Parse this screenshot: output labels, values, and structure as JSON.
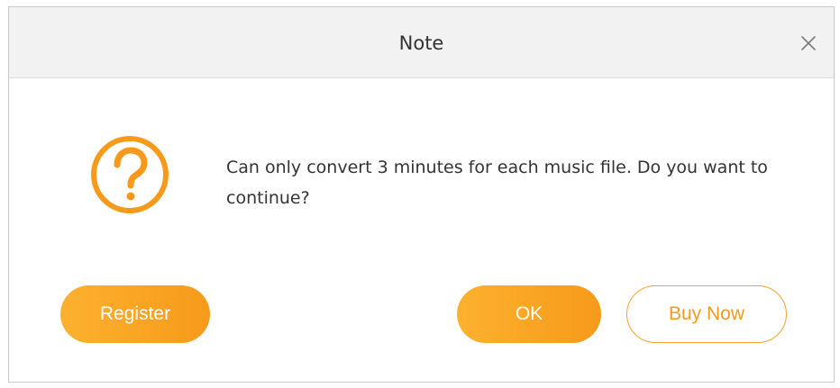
{
  "dialog": {
    "title": "Note",
    "message": "Can only convert 3 minutes for each music file. Do you want to continue?",
    "icon": "question-circle-icon",
    "close_icon": "close-icon"
  },
  "buttons": {
    "register_label": "Register",
    "ok_label": "OK",
    "buy_now_label": "Buy Now"
  },
  "colors": {
    "accent": "#f79a1b",
    "accent_light": "#fcb12e",
    "titlebar_bg": "#f2f2f2",
    "text": "#333333"
  }
}
